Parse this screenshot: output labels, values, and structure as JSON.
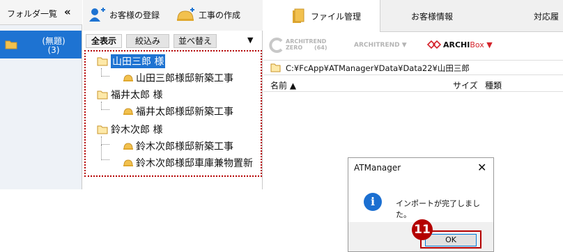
{
  "folder_pane": {
    "title": "フォルダ一覧",
    "collapse_label": "«",
    "item": {
      "name": "(無題)",
      "count": "(3)"
    }
  },
  "toolbar": {
    "register_label": "お客様の登録",
    "create_label": "工事の作成"
  },
  "filter_bar": {
    "all_label": "全表示",
    "filter_label": "絞込み",
    "sort_label": "並べ替え",
    "menu_glyph": "▼"
  },
  "tree": {
    "customers": [
      {
        "name": "山田三郎 様",
        "selected": true,
        "projects": [
          "山田三郎様邸新築工事"
        ]
      },
      {
        "name": "福井太郎 様",
        "selected": false,
        "projects": [
          "福井太郎様邸新築工事"
        ]
      },
      {
        "name": "鈴木次郎 様",
        "selected": false,
        "projects": [
          "鈴木次郎様邸新築工事",
          "鈴木次郎様邸車庫兼物置新"
        ]
      }
    ]
  },
  "tabs": [
    {
      "label": "ファイル管理"
    },
    {
      "label": "お客様情報"
    },
    {
      "label": "対応履"
    }
  ],
  "archi_bar": {
    "zero_line1": "ARCHITREND",
    "zero_line2": "ZERO",
    "zero_version": "(64)",
    "architrend_label": "ARCHITREND ▼",
    "archibox_bold": "ARCHI",
    "archibox_suffix": "Box ▼"
  },
  "path": "C:¥FcApp¥ATManager¥Data¥Data22¥山田三郎",
  "file_header": {
    "name": "名前 ▲",
    "size": "サイズ",
    "type": "種類"
  },
  "dialog": {
    "title": "ATManager",
    "close_label": "✕",
    "info_glyph": "i",
    "message": "インポートが完了しました。",
    "ok_label": "OK",
    "step_number": "11"
  },
  "colors": {
    "accent": "#1e73d2",
    "highlight": "#b40000",
    "folder": "#f2c14e"
  }
}
